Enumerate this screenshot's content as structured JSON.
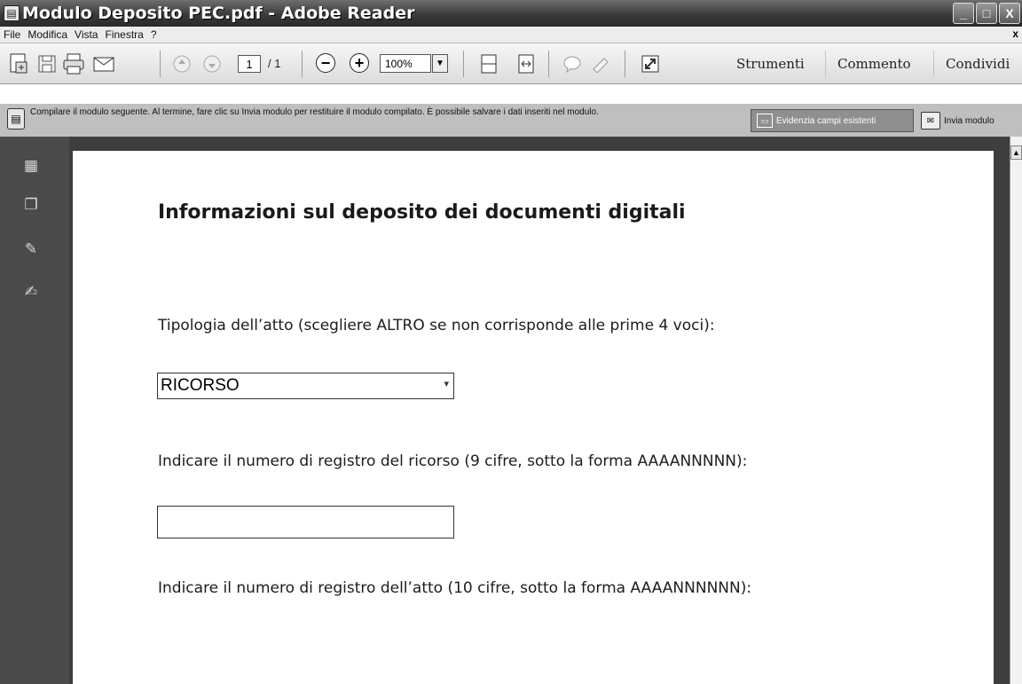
{
  "window": {
    "title": "Modulo Deposito PEC.pdf - Adobe Reader",
    "controls": {
      "minimize": "_",
      "maximize": "□",
      "close": "X"
    }
  },
  "menu": {
    "items": [
      "File",
      "Modifica",
      "Vista",
      "Finestra",
      "?"
    ],
    "close": "x"
  },
  "toolbar": {
    "page_current": "1",
    "page_total": "/ 1",
    "zoom_out": "−",
    "zoom_in": "+",
    "zoom_value": "100%",
    "tabs": [
      "Strumenti",
      "Commento",
      "Condividi"
    ]
  },
  "formbar": {
    "notice": "Compilare il modulo seguente. Al termine, fare clic su Invia modulo per restituire il modulo compilato. È possibile salvare i dati inseriti nel modulo.",
    "highlight_label": "Evidenzia campi esistenti",
    "submit_label": "Invia modulo"
  },
  "document": {
    "heading": "Informazioni sul deposito dei documenti digitali",
    "label_tipologia": "Tipologia dell’atto (scegliere ALTRO se non corrisponde alle prime 4 voci):",
    "tipologia_value": "RICORSO",
    "label_registro_ricorso": "Indicare il numero di registro del ricorso (9 cifre, sotto la forma AAAANNNNN):",
    "registro_ricorso_value": "",
    "label_registro_atto": "Indicare il numero di registro dell’atto (10 cifre, sotto la forma AAAANNNNNN):"
  },
  "icons": {
    "app": "adobe-reader-icon",
    "toolbar": [
      "create-pdf-icon",
      "save-icon",
      "print-icon",
      "email-icon",
      "previous-page-icon",
      "next-page-icon",
      "fit-page-icon",
      "fit-width-icon",
      "comment-icon",
      "highlight-icon",
      "fullscreen-icon"
    ],
    "nav": [
      "pages-icon",
      "bookmarks-icon",
      "attachments-icon",
      "signatures-icon"
    ]
  },
  "colors": {
    "titlebar": "#3a3a3a",
    "nav_pane": "#4a4a4a",
    "doc_background": "#3e3e3e"
  }
}
